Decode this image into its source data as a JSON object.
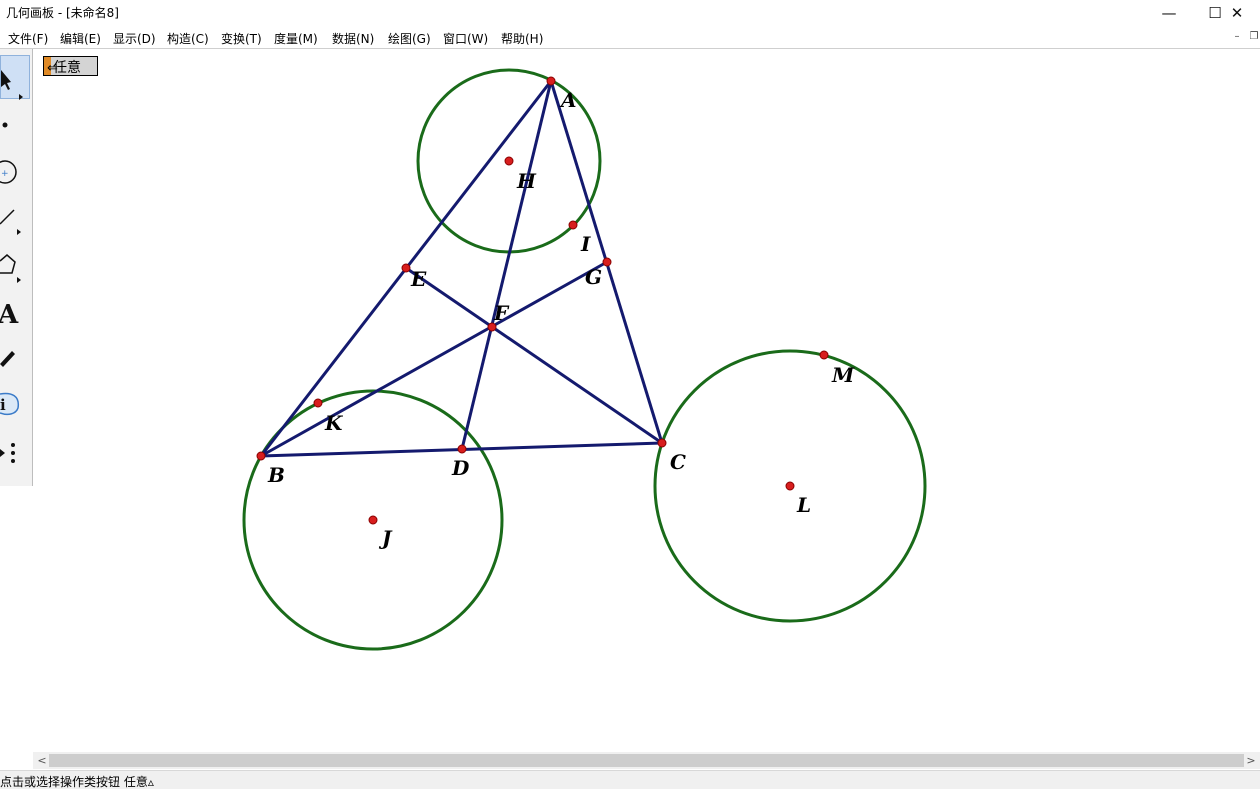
{
  "window": {
    "title": "几何画板 - [未命名8]",
    "minimize_icon": "minimize-icon",
    "maximize_icon": "maximize-icon",
    "close_icon": "close-icon",
    "minimize_glyph": "—",
    "maximize_glyph": "☐",
    "close_glyph": "✕"
  },
  "menu": {
    "items": [
      "文件(F)",
      "编辑(E)",
      "显示(D)",
      "构造(C)",
      "变换(T)",
      "度量(M)",
      "数据(N)",
      "绘图(G)",
      "窗口(W)",
      "帮助(H)"
    ],
    "mdi_min_glyph": "–",
    "mdi_restore_glyph": "❐"
  },
  "toolbar": {
    "tools": [
      "arrow-select-tool",
      "point-tool",
      "compass-tool",
      "straightedge-tool",
      "polygon-tool",
      "text-tool",
      "marker-tool",
      "information-tool",
      "custom-tool"
    ],
    "selected": "arrow-select-tool",
    "text_tool_glyph": "A"
  },
  "action_button": {
    "label": "任意",
    "arrow_glyph": "⇐"
  },
  "sketch": {
    "line_color": "#141a6e",
    "circle_color": "#1a6b1a",
    "point_color": "#d81e1e",
    "point_labels": {
      "A": "A",
      "B": "B",
      "C": "C",
      "D": "D",
      "E": "E",
      "F": "F",
      "G": "G",
      "H": "H",
      "I": "I",
      "J": "J",
      "K": "K",
      "L": "L",
      "M": "M"
    }
  },
  "scrollbar": {
    "left_glyph": "<",
    "right_glyph": ">"
  },
  "statusbar": {
    "text": "点击或选择操作类按钮 任意▵"
  }
}
